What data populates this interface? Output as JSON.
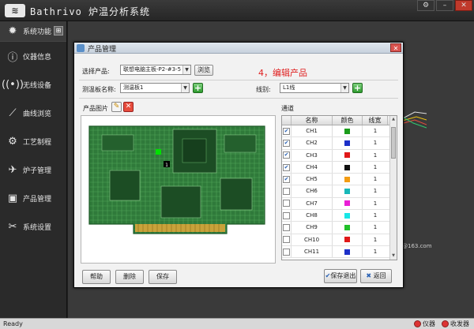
{
  "app": {
    "title": "Bathrivo 炉温分析系统",
    "logo_text": "≋"
  },
  "window_buttons": [
    "⚙",
    "–",
    "✕"
  ],
  "sidebar": {
    "items": [
      {
        "label": "系统功能",
        "icon": "gear-icon"
      },
      {
        "label": "仪器信息",
        "icon": "info-icon"
      },
      {
        "label": "无线设备",
        "icon": "wireless-icon"
      },
      {
        "label": "曲线浏览",
        "icon": "chart-icon"
      },
      {
        "label": "工艺制程",
        "icon": "settings-icon"
      },
      {
        "label": "炉子管理",
        "icon": "oven-icon"
      },
      {
        "label": "产品管理",
        "icon": "chip-icon"
      },
      {
        "label": "系统设置",
        "icon": "tools-icon"
      }
    ]
  },
  "background": {
    "email_fragment": "@163.com"
  },
  "dialog": {
    "title": "产品管理",
    "annotation": "4，编辑产品",
    "select_product_label": "选择产品:",
    "select_product_value": "联想电脑主板-P2-#3-5",
    "browse_label": "浏览",
    "board_name_label": "测温板名称:",
    "board_name_value": "测温板1",
    "line_label": "线别:",
    "line_value": "L1线",
    "product_image_label": "产品图片",
    "channels_label": "通道",
    "pcb_marker": "1",
    "columns": [
      "",
      "名称",
      "颜色",
      "线宽"
    ],
    "channels": [
      {
        "name": "CH1",
        "color": "#1a9c1a",
        "width": "1",
        "checked": true
      },
      {
        "name": "CH2",
        "color": "#1c2fc8",
        "width": "1",
        "checked": true
      },
      {
        "name": "CH3",
        "color": "#e01818",
        "width": "1",
        "checked": true
      },
      {
        "name": "CH4",
        "color": "#111111",
        "width": "1",
        "checked": true
      },
      {
        "name": "CH5",
        "color": "#f39c12",
        "width": "1",
        "checked": true
      },
      {
        "name": "CH6",
        "color": "#17b8b8",
        "width": "1",
        "checked": false
      },
      {
        "name": "CH7",
        "color": "#e91ed6",
        "width": "1",
        "checked": false
      },
      {
        "name": "CH8",
        "color": "#18e6e6",
        "width": "1",
        "checked": false
      },
      {
        "name": "CH9",
        "color": "#22c02a",
        "width": "1",
        "checked": false
      },
      {
        "name": "CH10",
        "color": "#e01818",
        "width": "1",
        "checked": false
      },
      {
        "name": "CH11",
        "color": "#1c2fc8",
        "width": "1",
        "checked": false
      }
    ],
    "buttons": {
      "help": "帮助",
      "delete": "删除",
      "save": "保存",
      "save_exit": "保存退出",
      "back": "返回"
    }
  },
  "status": {
    "ready": "Ready",
    "instrument": "仪器",
    "transmitter": "收发器"
  }
}
